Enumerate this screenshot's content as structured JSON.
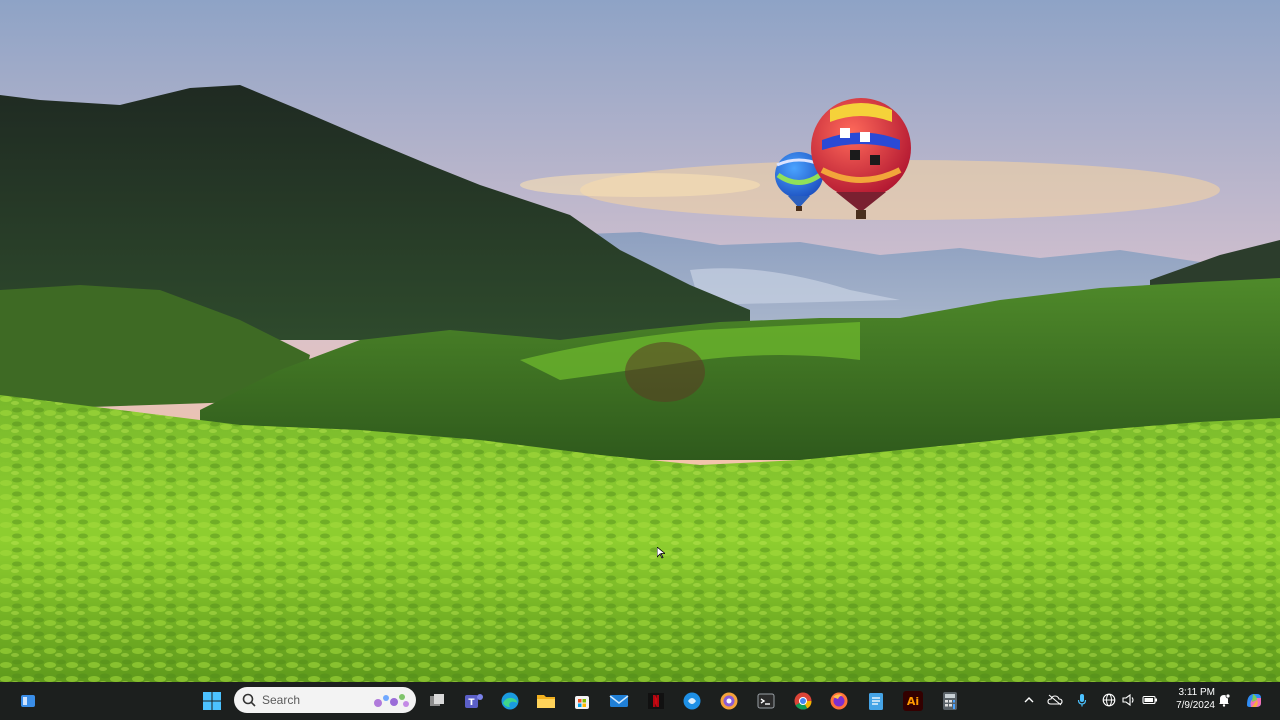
{
  "taskbar": {
    "search": {
      "placeholder": "Search"
    },
    "clock": {
      "time": "3:11 PM",
      "date": "7/9/2024"
    },
    "apps": [
      {
        "name": "Task view",
        "icon": "task-view-icon"
      },
      {
        "name": "Microsoft Teams",
        "icon": "teams-icon"
      },
      {
        "name": "Microsoft Edge",
        "icon": "edge-icon"
      },
      {
        "name": "File Explorer",
        "icon": "file-explorer-icon"
      },
      {
        "name": "Microsoft Store",
        "icon": "store-icon"
      },
      {
        "name": "Mail",
        "icon": "mail-icon"
      },
      {
        "name": "Netflix",
        "icon": "netflix-icon"
      },
      {
        "name": "Blue app",
        "icon": "blue-circle-icon"
      },
      {
        "name": "Circle app",
        "icon": "color-circle-icon"
      },
      {
        "name": "Terminal",
        "icon": "terminal-icon"
      },
      {
        "name": "Google Chrome",
        "icon": "chrome-icon"
      },
      {
        "name": "Firefox",
        "icon": "firefox-icon"
      },
      {
        "name": "Notepad",
        "icon": "notepad-icon"
      },
      {
        "name": "Adobe Illustrator",
        "icon": "illustrator-icon",
        "label": "Ai"
      },
      {
        "name": "Calculator",
        "icon": "calculator-icon"
      }
    ],
    "tray": [
      "chevron-up-icon",
      "cloud-off-icon",
      "microphone-icon",
      "globe-network-icon",
      "volume-icon",
      "battery-icon",
      "notification-bell-icon",
      "copilot-icon"
    ]
  },
  "colors": {
    "taskbar_bg": "#1c1f1e",
    "sky_top": "#8fa6c9",
    "sky_horizon": "#f3b8a0",
    "grass": "#7cc22a"
  }
}
